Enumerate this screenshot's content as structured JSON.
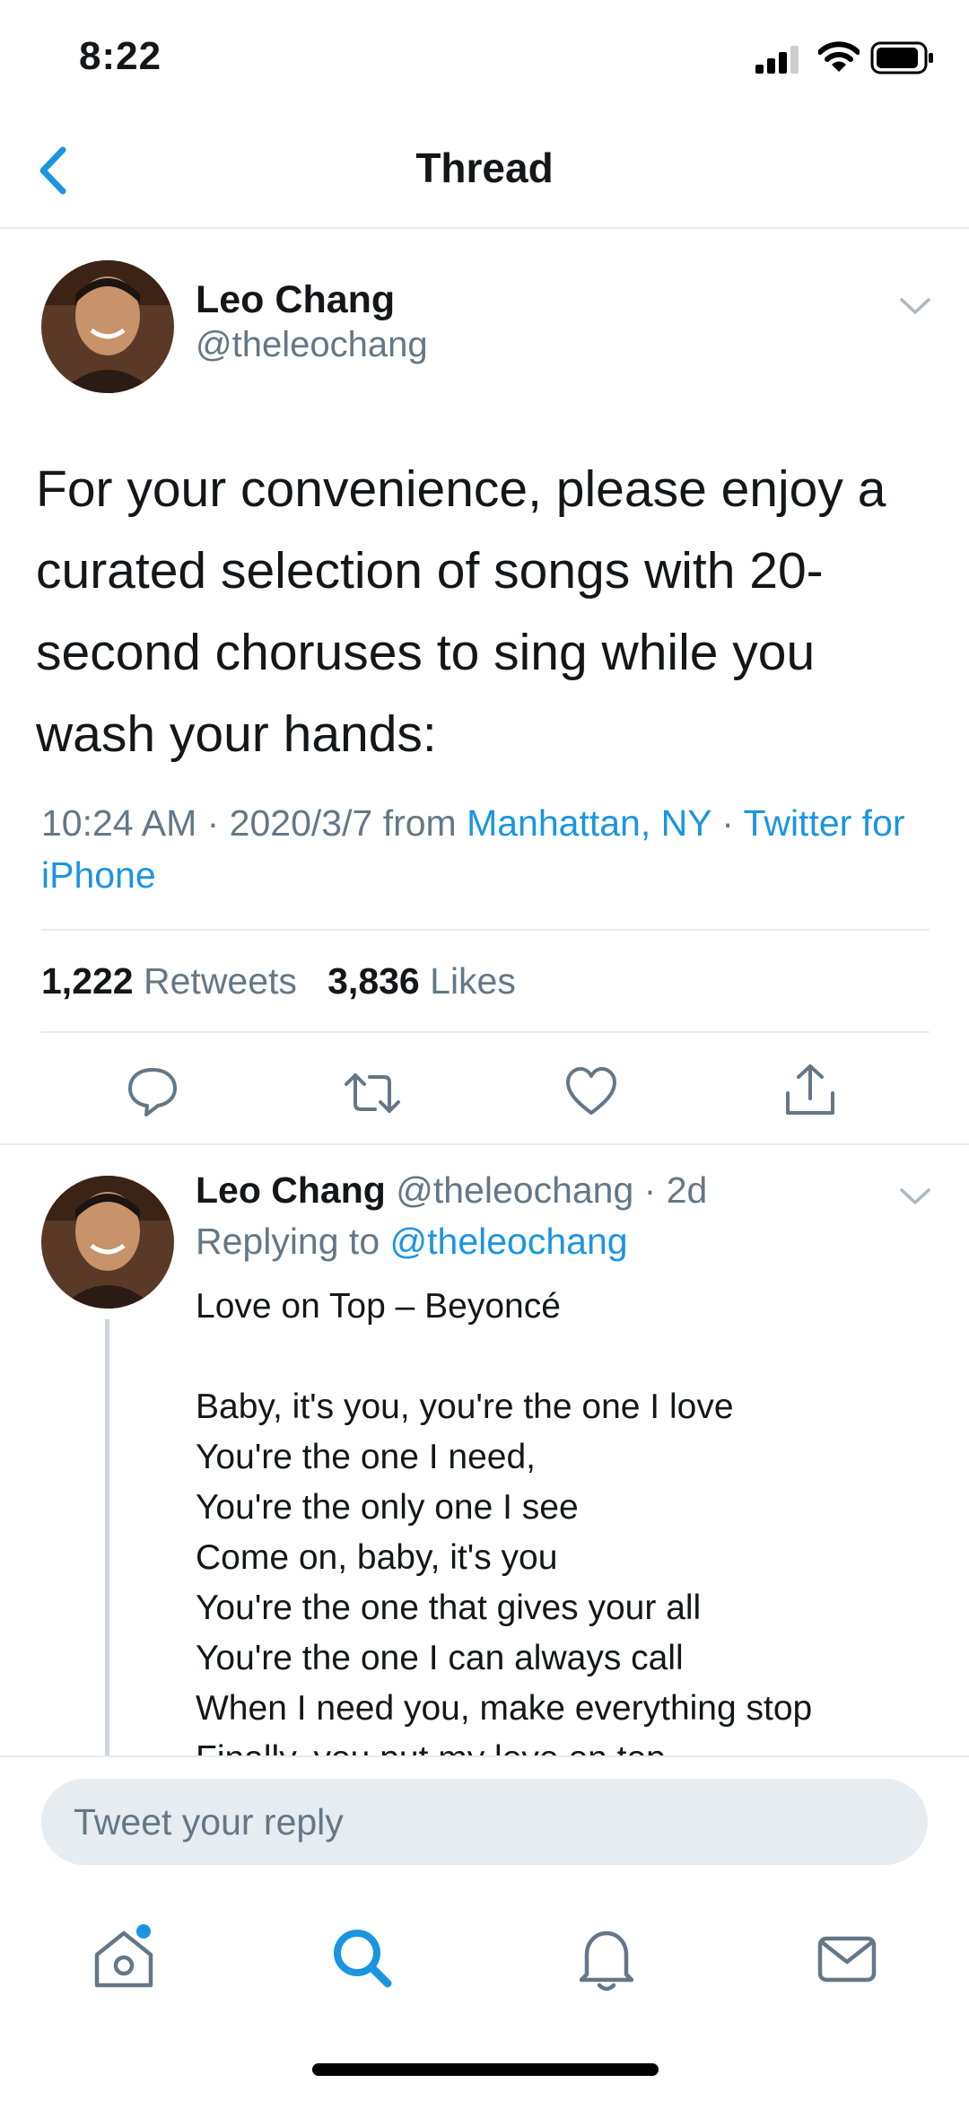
{
  "status_bar": {
    "time": "8:22"
  },
  "header": {
    "title": "Thread"
  },
  "main_tweet": {
    "author_name": "Leo Chang",
    "author_handle": "@theleochang",
    "text": "For your convenience, please enjoy a curated selection of songs with 20-second choruses to sing while you wash your hands:",
    "time": "10:24 AM",
    "date": "2020/3/7",
    "from_label": "from",
    "location": "Manhattan, NY",
    "client": "Twitter for iPhone",
    "retweets_count": "1,222",
    "retweets_label": "Retweets",
    "likes_count": "3,836",
    "likes_label": "Likes"
  },
  "reply_tweet": {
    "author_name": "Leo Chang",
    "author_handle": "@theleochang",
    "age": "2d",
    "replying_label": "Replying to",
    "replying_handle": "@theleochang",
    "lines": [
      "Love on Top – Beyoncé",
      "",
      "Baby, it's you, you're the one I love",
      "You're the one I need,",
      "You're the only one I see",
      "Come on, baby, it's you",
      "You're the one that gives your all",
      "You're the one I can always call",
      "When I need you, make everything stop",
      "Finally, you put my love on top"
    ]
  },
  "composer": {
    "placeholder": "Tweet your reply"
  },
  "colors": {
    "accent": "#1b95e0",
    "secondary_text": "#657786",
    "divider": "#e6ecf0"
  },
  "icons": [
    "back-icon",
    "chevron-down-icon",
    "reply-icon",
    "retweet-icon",
    "like-icon",
    "share-icon",
    "home-icon",
    "search-icon",
    "notifications-icon",
    "messages-icon"
  ]
}
